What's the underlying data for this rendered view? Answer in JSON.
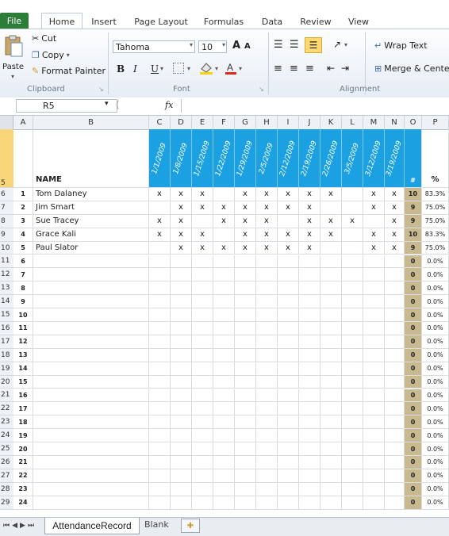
{
  "ribbon_tabs": [
    "File",
    "Home",
    "Insert",
    "Page Layout",
    "Formulas",
    "Data",
    "Review",
    "View"
  ],
  "clipboard": {
    "paste": "Paste",
    "cut": "Cut",
    "copy": "Copy",
    "format_painter": "Format Painter",
    "label": "Clipboard"
  },
  "font": {
    "name": "Tahoma",
    "size": "10",
    "label": "Font",
    "bold": "B",
    "italic": "I",
    "underline": "U",
    "grow": "A",
    "shrink": "A"
  },
  "alignment": {
    "wrap_text": "Wrap Text",
    "merge_center": "Merge & Cente",
    "label": "Alignment"
  },
  "formula_bar": {
    "name_box": "R5",
    "fx": "fx",
    "value": ""
  },
  "columns": [
    "A",
    "B",
    "C",
    "D",
    "E",
    "F",
    "G",
    "H",
    "I",
    "J",
    "K",
    "L",
    "M",
    "N",
    "O",
    "P"
  ],
  "header_row": {
    "row_num": "5",
    "name_label": "NAME",
    "count_label": "#",
    "pct_label": "%"
  },
  "dates": [
    "1/1/2009",
    "1/8/2009",
    "1/15/2009",
    "1/22/2009",
    "1/29/2009",
    "2/5/2009",
    "2/12/2009",
    "2/19/2009",
    "2/26/2009",
    "3/5/2009",
    "3/12/2009",
    "3/19/2009"
  ],
  "rows": [
    {
      "row": "6",
      "id": "1",
      "name": "Tom Dalaney",
      "marks": [
        "x",
        "x",
        "x",
        "",
        "x",
        "x",
        "x",
        "x",
        "x",
        "",
        "x",
        "x"
      ],
      "count": "10",
      "pct": "83.3%"
    },
    {
      "row": "7",
      "id": "2",
      "name": "Jim Smart",
      "marks": [
        "",
        "x",
        "x",
        "x",
        "x",
        "x",
        "x",
        "x",
        "",
        "",
        "x",
        "x"
      ],
      "count": "9",
      "pct": "75.0%"
    },
    {
      "row": "8",
      "id": "3",
      "name": "Sue Tracey",
      "marks": [
        "x",
        "x",
        "",
        "x",
        "x",
        "x",
        "",
        "x",
        "x",
        "x",
        "",
        "x"
      ],
      "count": "9",
      "pct": "75.0%"
    },
    {
      "row": "9",
      "id": "4",
      "name": "Grace Kali",
      "marks": [
        "x",
        "x",
        "x",
        "",
        "x",
        "x",
        "x",
        "x",
        "x",
        "",
        "x",
        "x"
      ],
      "count": "10",
      "pct": "83.3%"
    },
    {
      "row": "10",
      "id": "5",
      "name": "Paul Slator",
      "marks": [
        "",
        "x",
        "x",
        "x",
        "x",
        "x",
        "x",
        "x",
        "",
        "",
        "x",
        "x"
      ],
      "count": "9",
      "pct": "75.0%"
    },
    {
      "row": "11",
      "id": "6",
      "name": "",
      "marks": [],
      "count": "0",
      "pct": "0.0%"
    },
    {
      "row": "12",
      "id": "7",
      "name": "",
      "marks": [],
      "count": "0",
      "pct": "0.0%"
    },
    {
      "row": "13",
      "id": "8",
      "name": "",
      "marks": [],
      "count": "0",
      "pct": "0.0%"
    },
    {
      "row": "14",
      "id": "9",
      "name": "",
      "marks": [],
      "count": "0",
      "pct": "0.0%"
    },
    {
      "row": "15",
      "id": "10",
      "name": "",
      "marks": [],
      "count": "0",
      "pct": "0.0%"
    },
    {
      "row": "16",
      "id": "11",
      "name": "",
      "marks": [],
      "count": "0",
      "pct": "0.0%"
    },
    {
      "row": "17",
      "id": "12",
      "name": "",
      "marks": [],
      "count": "0",
      "pct": "0.0%"
    },
    {
      "row": "18",
      "id": "13",
      "name": "",
      "marks": [],
      "count": "0",
      "pct": "0.0%"
    },
    {
      "row": "19",
      "id": "14",
      "name": "",
      "marks": [],
      "count": "0",
      "pct": "0.0%"
    },
    {
      "row": "20",
      "id": "15",
      "name": "",
      "marks": [],
      "count": "0",
      "pct": "0.0%"
    },
    {
      "row": "21",
      "id": "16",
      "name": "",
      "marks": [],
      "count": "0",
      "pct": "0.0%"
    },
    {
      "row": "22",
      "id": "17",
      "name": "",
      "marks": [],
      "count": "0",
      "pct": "0.0%"
    },
    {
      "row": "23",
      "id": "18",
      "name": "",
      "marks": [],
      "count": "0",
      "pct": "0.0%"
    },
    {
      "row": "24",
      "id": "19",
      "name": "",
      "marks": [],
      "count": "0",
      "pct": "0.0%"
    },
    {
      "row": "25",
      "id": "20",
      "name": "",
      "marks": [],
      "count": "0",
      "pct": "0.0%"
    },
    {
      "row": "26",
      "id": "21",
      "name": "",
      "marks": [],
      "count": "0",
      "pct": "0.0%"
    },
    {
      "row": "27",
      "id": "22",
      "name": "",
      "marks": [],
      "count": "0",
      "pct": "0.0%"
    },
    {
      "row": "28",
      "id": "23",
      "name": "",
      "marks": [],
      "count": "0",
      "pct": "0.0%"
    },
    {
      "row": "29",
      "id": "24",
      "name": "",
      "marks": [],
      "count": "0",
      "pct": "0.0%"
    }
  ],
  "sheets": [
    "AttendanceRecord",
    "Blank"
  ],
  "colors": {
    "date_header": "#1ba1e2",
    "count_column": "#c9b98f",
    "file_tab": "#2d7d3a"
  }
}
